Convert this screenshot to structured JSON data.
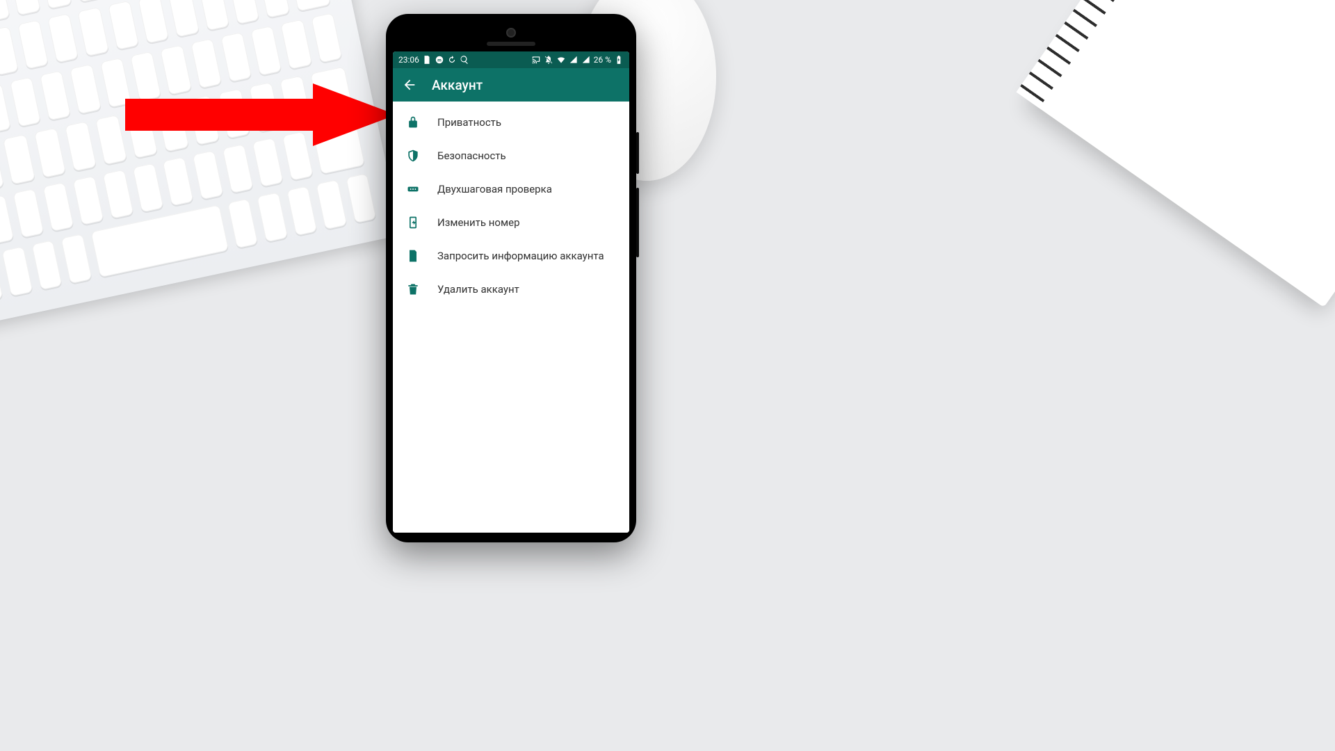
{
  "statusbar": {
    "time": "23:06",
    "battery_text": "26 %"
  },
  "appbar": {
    "title": "Аккаунт"
  },
  "menu": {
    "items": [
      {
        "icon": "lock-icon",
        "label": "Приватность"
      },
      {
        "icon": "shield-icon",
        "label": "Безопасность"
      },
      {
        "icon": "password-icon",
        "label": "Двухшаговая проверка"
      },
      {
        "icon": "simcard-icon",
        "label": "Изменить номер"
      },
      {
        "icon": "document-icon",
        "label": "Запросить информацию аккаунта"
      },
      {
        "icon": "trash-icon",
        "label": "Удалить аккаунт"
      }
    ]
  },
  "annotation": {
    "arrow_color": "#ff0000",
    "target_item_index": 0
  }
}
